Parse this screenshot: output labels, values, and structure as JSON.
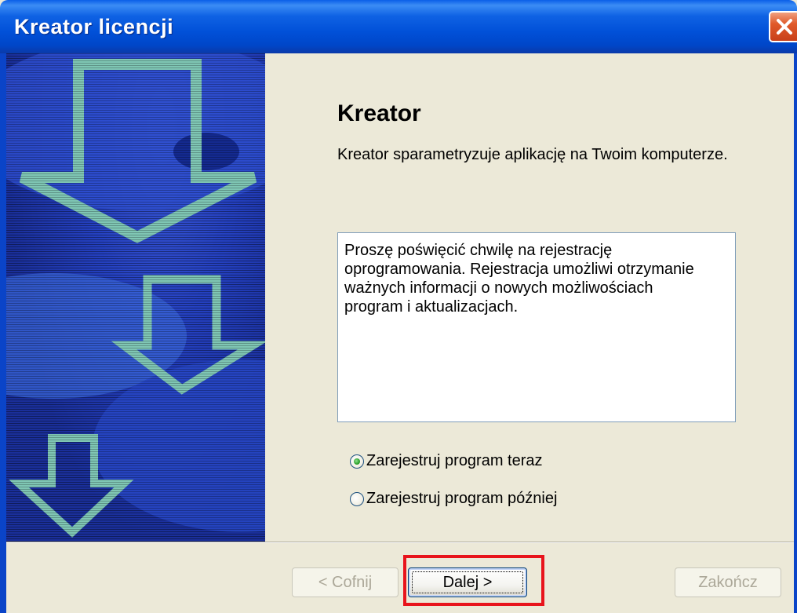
{
  "window": {
    "title": "Kreator licencji"
  },
  "content": {
    "heading": "Kreator",
    "subtitle": "Kreator sparametryzuje aplikację na Twoim komputerze.",
    "info_lines": [
      "Proszę poświęcić chwilę na rejestrację",
      "oprogramowania. Rejestracja umożliwi otrzymanie",
      "ważnych informacji o nowych możliwościach",
      "program i aktualizacjach."
    ],
    "radio_now": {
      "label": "Zarejestruj program teraz",
      "selected": true
    },
    "radio_later": {
      "label": "Zarejestruj program później",
      "selected": false
    }
  },
  "buttons": {
    "back": {
      "label": "< Cofnij",
      "enabled": false
    },
    "next": {
      "label": "Dalej >",
      "enabled": true
    },
    "finish": {
      "label": "Zakończ",
      "enabled": false
    }
  },
  "colors": {
    "title_bar": "#0050d8",
    "banner": "#1a36b0",
    "arrow": "#7fc6b4",
    "highlight": "#e8141c"
  }
}
